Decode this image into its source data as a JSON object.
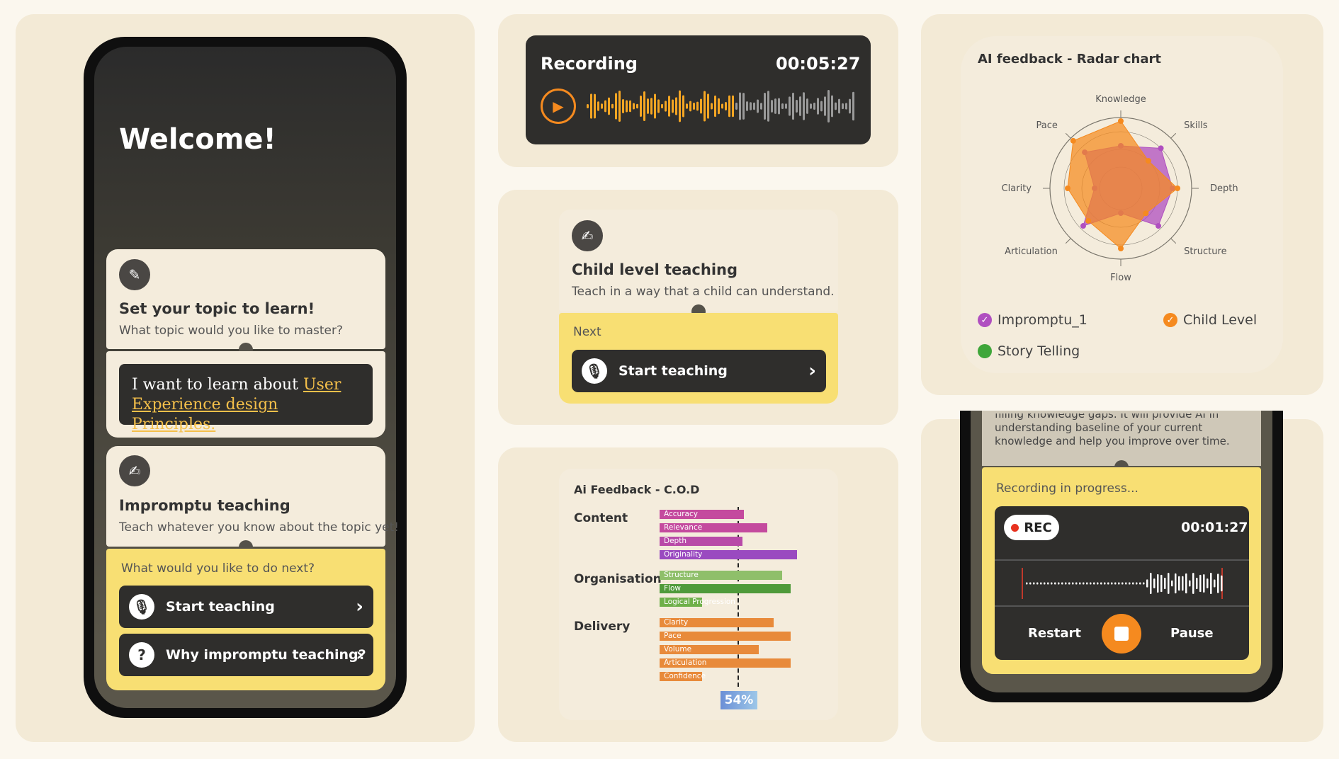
{
  "phone1": {
    "welcome": "Welcome!",
    "topic_card": {
      "title": "Set your topic to learn!",
      "subtitle": "What topic would you like to master?"
    },
    "topic_input": {
      "prefix": "I want to learn about ",
      "topic": "User Experience design Principles."
    },
    "impromptu_card": {
      "title": "Impromptu teaching",
      "subtitle": "Teach whatever you know about the topic yet!"
    },
    "next_prompt": "What would you like to do next?",
    "start_button": "Start teaching",
    "why_button": "Why impromptu teaching?"
  },
  "recording": {
    "title": "Recording",
    "time": "00:05:27"
  },
  "child_card": {
    "title": "Child level teaching",
    "subtitle": "Teach in a way that a child can understand.",
    "next_label": "Next",
    "start_button": "Start teaching"
  },
  "radar": {
    "title": "AI feedback - Radar chart",
    "legend": [
      "Impromptu_1",
      "Child Level",
      "Story Telling"
    ]
  },
  "cod": {
    "title": "Ai Feedback - C.O.D",
    "summary": "54%"
  },
  "phone2": {
    "text_lines": [
      "filling knowledge gaps. It will provide AI in",
      "understanding baseline of your current",
      "knowledge and help you improve over time."
    ],
    "status": "Recording in progress...",
    "rec_label": "REC",
    "time": "00:01:27",
    "restart": "Restart",
    "pause": "Pause"
  },
  "colors": {
    "accent_yellow": "#f8df73",
    "dark": "#2f2e2c",
    "orange": "#f58a1f",
    "purple": "#b04fc0",
    "green": "#3fa63a"
  },
  "chart_data": [
    {
      "type": "radar",
      "title": "AI feedback - Radar chart",
      "axes": [
        "Knowledge",
        "Skills",
        "Depth",
        "Structure",
        "Flow",
        "Articulation",
        "Clarity",
        "Pace"
      ],
      "series": [
        {
          "name": "Impromptu_1",
          "values": [
            0.6,
            0.8,
            0.73,
            0.75,
            0.35,
            0.75,
            0.37,
            0.72
          ]
        },
        {
          "name": "Child Level",
          "values": [
            0.95,
            0.55,
            0.8,
            0.5,
            0.85,
            0.65,
            0.75,
            0.95
          ]
        }
      ]
    },
    {
      "type": "bar",
      "title": "Ai Feedback - C.O.D",
      "groups": [
        {
          "name": "Content",
          "categories": [
            "Accuracy",
            "Relevance",
            "Depth",
            "Originality"
          ],
          "values": [
            3,
            14,
            -11,
            28
          ]
        },
        {
          "name": "Organisation",
          "categories": [
            "Structure",
            "Flow",
            "Logical Progression"
          ],
          "values": [
            21,
            25,
            -30
          ]
        },
        {
          "name": "Delivery",
          "categories": [
            "Clarity",
            "Pace",
            "Volume",
            "Articulation",
            "Confidence"
          ],
          "values": [
            17,
            25,
            10,
            25,
            -30
          ]
        }
      ],
      "summary": "54%"
    }
  ]
}
